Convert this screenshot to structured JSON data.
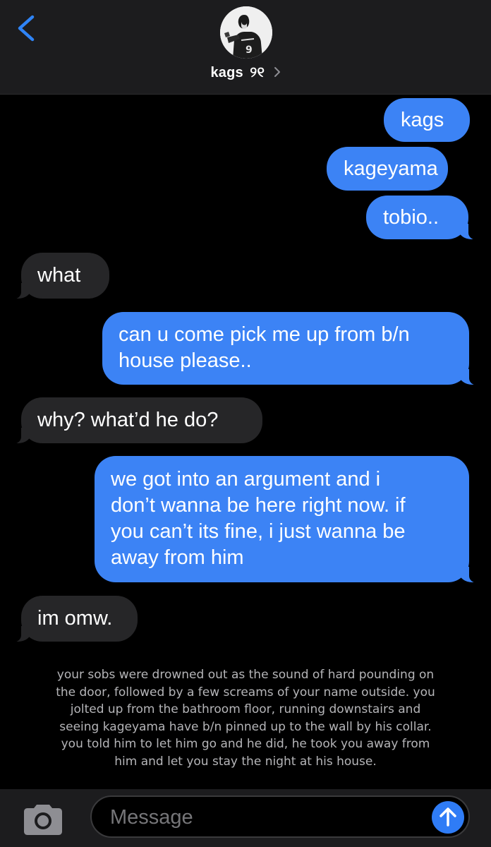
{
  "header": {
    "back_icon": "chevron-left-icon",
    "avatar_icon": "contact-avatar",
    "contact_name": "kags",
    "contact_emoji": "୨୧",
    "chevron_icon": "chevron-right-icon"
  },
  "messages": [
    {
      "from": "me",
      "text": "kags"
    },
    {
      "from": "me",
      "text": "kageyama"
    },
    {
      "from": "me",
      "text": "tobio.."
    },
    {
      "from": "them",
      "text": "what"
    },
    {
      "from": "me",
      "lines": [
        "can u come pick me up from b/n",
        "house please.."
      ]
    },
    {
      "from": "them",
      "text": "why? what’d he do?"
    },
    {
      "from": "me",
      "lines": [
        "we got into an argument and i",
        "don’t wanna be here right now. if",
        "you can’t its fine, i just wanna be",
        "away from him"
      ]
    },
    {
      "from": "them",
      "text": "im omw."
    }
  ],
  "narration": {
    "lines": [
      "your sobs were drowned out as the sound of hard pounding on",
      "the door, followed by a few screams of your name outside. you",
      "jolted up from the bathroom floor, running downstairs and",
      "seeing kageyama have b/n pinned up to the wall by his collar.",
      "you told him to let him go and he did, he took you away from",
      "him and let you stay the night at his house."
    ]
  },
  "input_bar": {
    "camera_icon": "camera-icon",
    "placeholder": "Message",
    "value": "",
    "send_icon": "arrow-up-icon"
  },
  "colors": {
    "background": "#000000",
    "header_bg": "#1c1c1e",
    "sent_bubble": "#3c83f5",
    "received_bubble": "#262628",
    "accent": "#2f7cf6",
    "narration_text": "#b5b5b8"
  }
}
